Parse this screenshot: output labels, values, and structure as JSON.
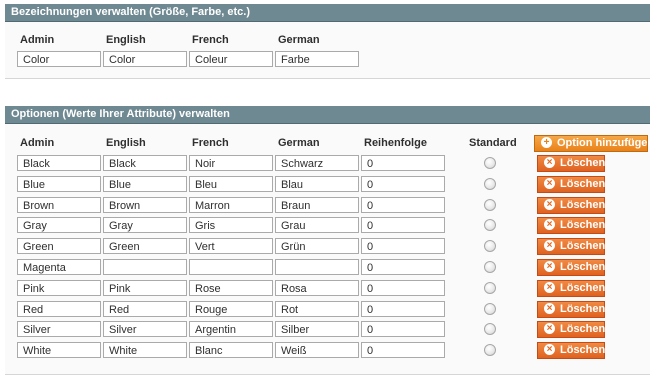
{
  "labels_section": {
    "title": "Bezeichnungen verwalten (Größe, Farbe, etc.)",
    "headers": [
      "Admin",
      "English",
      "French",
      "German"
    ],
    "values": [
      "Color",
      "Color",
      "Coleur",
      "Farbe"
    ]
  },
  "options_section": {
    "title": "Optionen (Werte Ihrer Attribute) verwalten",
    "headers": [
      "Admin",
      "English",
      "French",
      "German",
      "Reihenfolge",
      "Standard"
    ],
    "add_button": "Option hinzufügen",
    "delete_label": "Löschen",
    "rows": [
      {
        "admin": "Black",
        "english": "Black",
        "french": "Noir",
        "german": "Schwarz",
        "order": "0"
      },
      {
        "admin": "Blue",
        "english": "Blue",
        "french": "Bleu",
        "german": "Blau",
        "order": "0"
      },
      {
        "admin": "Brown",
        "english": "Brown",
        "french": "Marron",
        "german": "Braun",
        "order": "0"
      },
      {
        "admin": "Gray",
        "english": "Gray",
        "french": "Gris",
        "german": "Grau",
        "order": "0"
      },
      {
        "admin": "Green",
        "english": "Green",
        "french": "Vert",
        "german": "Grün",
        "order": "0"
      },
      {
        "admin": "Magenta",
        "english": "",
        "french": "",
        "german": "",
        "order": "0"
      },
      {
        "admin": "Pink",
        "english": "Pink",
        "french": "Rose",
        "german": "Rosa",
        "order": "0"
      },
      {
        "admin": "Red",
        "english": "Red",
        "french": "Rouge",
        "german": "Rot",
        "order": "0"
      },
      {
        "admin": "Silver",
        "english": "Silver",
        "french": "Argentin",
        "german": "Silber",
        "order": "0"
      },
      {
        "admin": "White",
        "english": "White",
        "french": "Blanc",
        "german": "Weiß",
        "order": "0"
      }
    ]
  },
  "colors": {
    "section_header": "#6f8992",
    "button_orange": "#e3661f",
    "add_button_orange": "#f0951f"
  }
}
